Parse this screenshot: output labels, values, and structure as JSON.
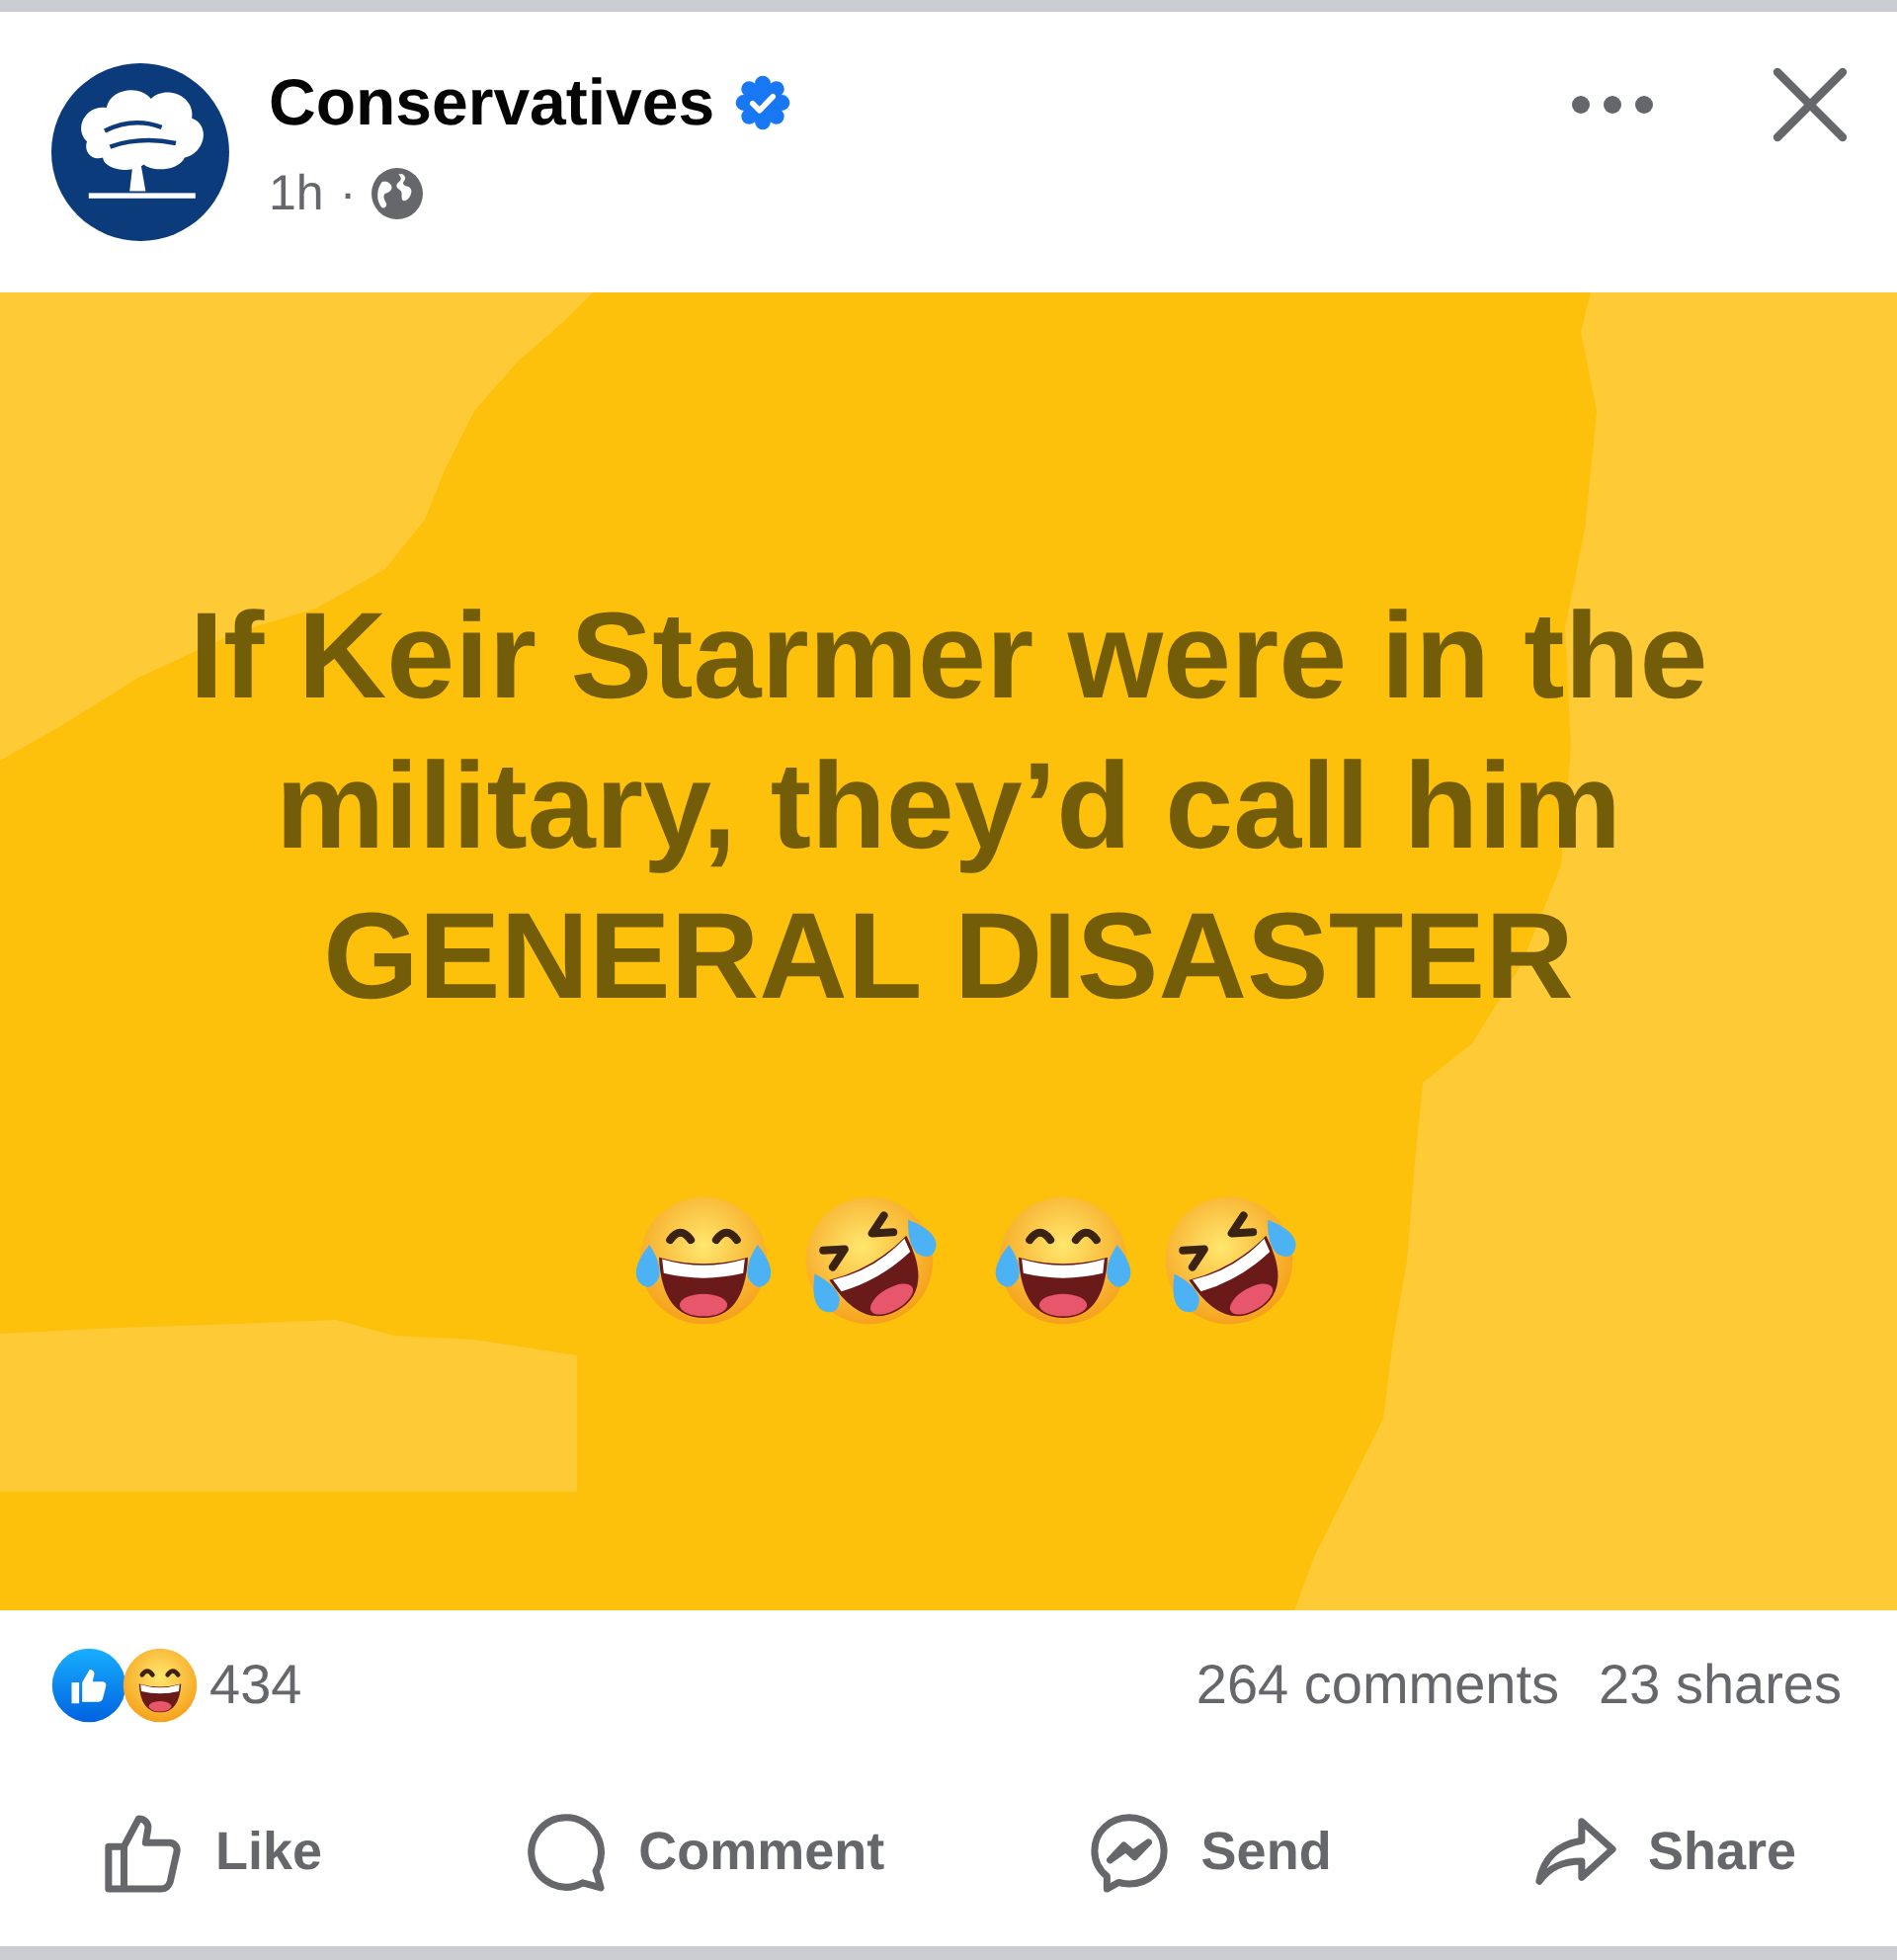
{
  "header": {
    "author": {
      "name": "Conservatives",
      "verified": true
    },
    "time": "1h",
    "separator": "·"
  },
  "post_image": {
    "text": "If Keir Starmer were in the military, they’d call him\nGENERAL DISASTER",
    "emoji_groups": [
      {
        "emojis": [
          {
            "kind": "tears_of_joy"
          },
          {
            "kind": "rolling_on_floor"
          }
        ]
      },
      {
        "emojis": [
          {
            "kind": "tears_of_joy"
          },
          {
            "kind": "rolling_on_floor"
          }
        ]
      }
    ]
  },
  "reactions": {
    "icons": [
      {
        "kind": "like"
      },
      {
        "kind": "haha"
      }
    ],
    "count": "434"
  },
  "stats": {
    "comments": "264 comments",
    "shares": "23 shares"
  },
  "actions": [
    {
      "kind": "like",
      "label": "Like"
    },
    {
      "kind": "comment",
      "label": "Comment"
    },
    {
      "kind": "send",
      "label": "Send"
    },
    {
      "kind": "share",
      "label": "Share"
    }
  ]
}
